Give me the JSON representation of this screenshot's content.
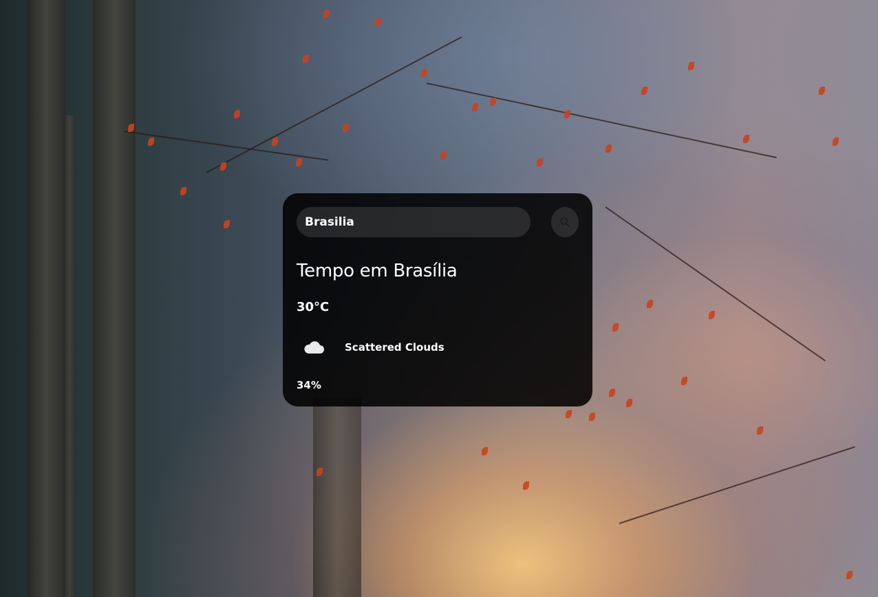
{
  "search": {
    "value": "Brasilia",
    "button_icon": "search-icon"
  },
  "weather": {
    "title": "Tempo em Brasília",
    "temperature": "30°C",
    "condition": "Scattered Clouds",
    "condition_icon": "cloud-icon",
    "humidity": "34%"
  },
  "colors": {
    "card_background": "#000000",
    "text": "#ffffff",
    "input_background": "#7c7c7c"
  }
}
